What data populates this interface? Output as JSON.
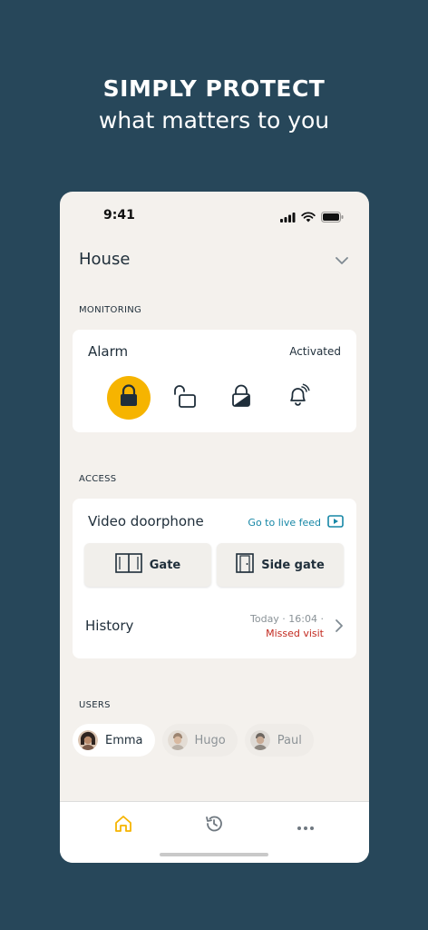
{
  "hero": {
    "title": "SIMPLY PROTECT",
    "subtitle": "what matters to you"
  },
  "status_bar": {
    "time": "9:41",
    "icons": [
      "signal-icon",
      "wifi-icon",
      "battery-icon"
    ]
  },
  "header": {
    "title": "House",
    "dropdown_icon": "chevron-down-icon"
  },
  "monitoring": {
    "section_label": "MONITORING",
    "alarm_title": "Alarm",
    "alarm_status": "Activated",
    "modes": [
      {
        "icon": "lock-closed-icon",
        "active": true
      },
      {
        "icon": "lock-open-icon",
        "active": false
      },
      {
        "icon": "lock-partial-icon",
        "active": false
      },
      {
        "icon": "bell-alert-icon",
        "active": false
      }
    ],
    "accent_color": "#f6b400"
  },
  "access": {
    "section_label": "ACCESS",
    "doorphone_title": "Video doorphone",
    "live_feed_label": "Go to live feed",
    "gate_label": "Gate",
    "side_gate_label": "Side gate",
    "history_label": "History",
    "history_date": "Today · 16:04 ·",
    "history_event": "Missed visit"
  },
  "users": {
    "section_label": "USERS",
    "list": [
      {
        "name": "Emma",
        "active": true
      },
      {
        "name": "Hugo",
        "active": false
      },
      {
        "name": "Paul",
        "active": false
      }
    ]
  },
  "tabbar": {
    "tabs": [
      "home-icon",
      "history-icon",
      "more-icon"
    ],
    "active_color": "#f6b400"
  }
}
